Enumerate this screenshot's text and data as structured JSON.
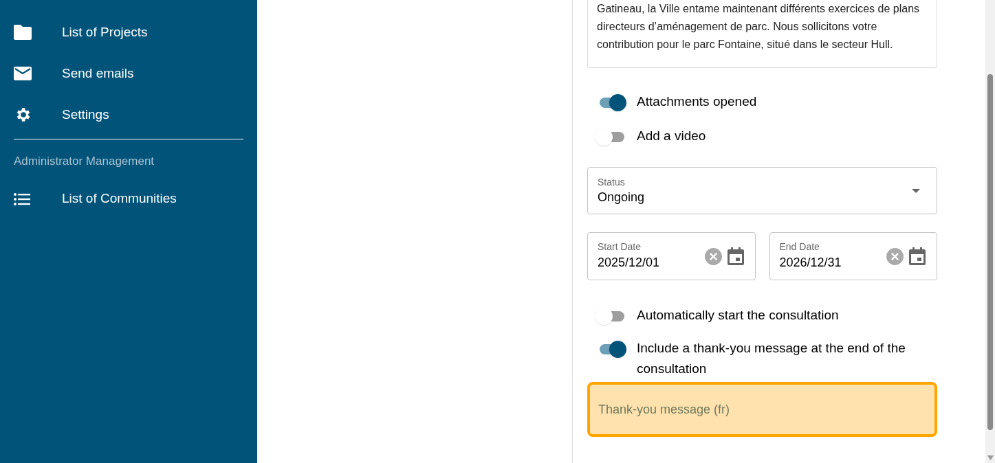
{
  "sidebar": {
    "items": [
      {
        "label": "List of Projects",
        "kind": "folder"
      },
      {
        "label": "Send emails",
        "kind": "mail"
      },
      {
        "label": "Settings",
        "kind": "gear"
      }
    ],
    "section_title": "Administrator Management",
    "section_items": [
      {
        "label": "List of Communities",
        "kind": "list"
      }
    ]
  },
  "form": {
    "description": "Gatineau, la Ville entame maintenant différents exercices de plans directeurs d’aménagement de parc. Nous sollicitons votre contribution pour le parc Fontaine, situé dans le secteur Hull.",
    "toggles_top": [
      {
        "label": "Attachments opened",
        "on": true
      },
      {
        "label": "Add a video",
        "on": false
      }
    ],
    "status": {
      "label": "Status",
      "value": "Ongoing"
    },
    "dates": [
      {
        "label": "Start Date",
        "value": "2025/12/01"
      },
      {
        "label": "End Date",
        "value": "2026/12/31"
      }
    ],
    "toggles_bottom": [
      {
        "label": "Automatically start the consultation",
        "on": false
      },
      {
        "label": "Include a thank-you message at the end of the consultation",
        "on": true
      }
    ],
    "thank_you": {
      "placeholder": "Thank-you message (fr)",
      "focused": true
    }
  }
}
